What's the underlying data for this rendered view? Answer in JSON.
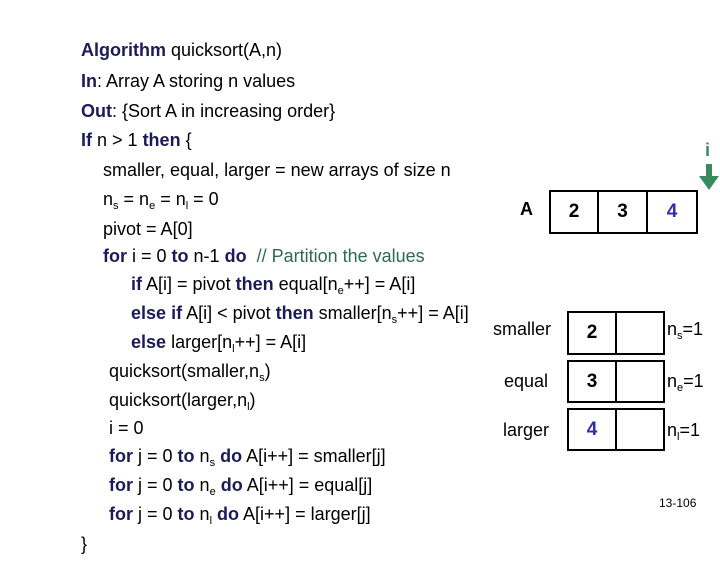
{
  "algorithm": {
    "header": {
      "kw": "Algorithm",
      "text": " quicksort(A,n)"
    },
    "input": {
      "kw": "In",
      "text": ": Array A storing n values"
    },
    "output": {
      "kw": "Out",
      "text": ": {Sort A in increasing order}"
    },
    "if_line": {
      "kw1": "If",
      "text1": " n > 1 ",
      "kw2": "then",
      "text2": " {"
    },
    "new_arrays": "smaller, equal, larger = new arrays of size n",
    "counters": {
      "n": "n",
      "s": "s",
      "e": "e",
      "l": "l",
      "eq": " = ",
      "zero": " = 0"
    },
    "pivot": "pivot = A[0]",
    "for_partition": {
      "kw_for": "for",
      "t1": " i = 0 ",
      "kw_to": "to",
      "t2": " n-1 ",
      "kw_do": "do",
      "comment": "  // Partition the values"
    },
    "if_equal": {
      "kw_if": "if",
      "t1": " A[i] = pivot ",
      "kw_then": "then",
      "t2": " equal[n",
      "sub": "e",
      "t3": "++] = A[i]"
    },
    "elseif_smaller": {
      "kw_else": "else",
      "kw_if": "if",
      "t1": " A[i] < pivot ",
      "kw_then": "then",
      "t2": " smaller[n",
      "sub": "s",
      "t3": "++] = A[i]"
    },
    "else_larger": {
      "kw_else": "else",
      "t1": " larger[n",
      "sub": "l",
      "t2": "++] = A[i]"
    },
    "rec_smaller": {
      "t1": "quicksort(smaller,n",
      "sub": "s",
      "t2": ")"
    },
    "rec_larger": {
      "t1": "quicksort(larger,n",
      "sub": "l",
      "t2": ")"
    },
    "reset_i": "i = 0",
    "copy_smaller": {
      "kw_for": "for",
      "t1": " j = 0 ",
      "kw_to": "to",
      "t2": " n",
      "sub": "s",
      "kw_do": "do",
      "t3": " A[i++] = smaller[j]"
    },
    "copy_equal": {
      "kw_for": "for",
      "t1": " j = 0 ",
      "kw_to": "to",
      "t2": " n",
      "sub": "e",
      "kw_do": "do",
      "t3": " A[i++] = equal[j]"
    },
    "copy_larger": {
      "kw_for": "for",
      "t1": " j = 0 ",
      "kw_to": "to",
      "t2": " n",
      "sub": "l",
      "kw_do": "do",
      "t3": " A[i++] = larger[j]"
    },
    "close_brace": "}"
  },
  "diagram": {
    "index_label": "i",
    "array_a": {
      "label": "A",
      "cells": [
        "2",
        "3",
        "4"
      ],
      "highlight_index": 2
    },
    "smaller": {
      "label": "smaller",
      "cells": [
        "2",
        ""
      ],
      "count_n": "n",
      "count_sub": "s",
      "count_val": "=1"
    },
    "equal": {
      "label": "equal",
      "cells": [
        "3",
        ""
      ],
      "count_n": "n",
      "count_sub": "e",
      "count_val": "=1"
    },
    "larger": {
      "label": "larger",
      "cells": [
        "4",
        ""
      ],
      "count_n": "n",
      "count_sub": "l",
      "count_val": "=1"
    },
    "colors": {
      "keyword": "#1b1b5c",
      "comment": "#2f6b4c",
      "highlight_value": "#2e2eb0",
      "index_arrow": "#3a8a60"
    }
  },
  "page_number": "13-106"
}
